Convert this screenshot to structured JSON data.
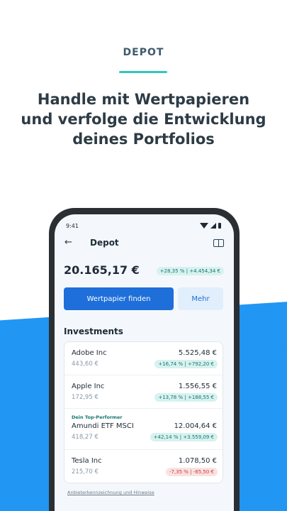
{
  "promo": {
    "tag": "DEPOT",
    "headline_line1": "Handle mit Wertpapieren",
    "headline_line2": "und verfolge die Entwicklung",
    "headline_line3": "deines Portfolios"
  },
  "status_bar": {
    "time": "9:41"
  },
  "app_bar": {
    "back_icon": "←",
    "title": "Depot",
    "info_icon": "book-icon"
  },
  "portfolio": {
    "total": "20.165,17 €",
    "change": "+28,35 % | +4.454,34 €"
  },
  "actions": {
    "primary_label": "Wertpapier finden",
    "secondary_label": "Mehr"
  },
  "investments": {
    "title": "Investments",
    "items": [
      {
        "name": "Adobe Inc",
        "value": "5.525,48 €",
        "price": "443,60 €",
        "change": "+16,74 % | +792,20 €",
        "trend": "pos",
        "tag": ""
      },
      {
        "name": "Apple Inc",
        "value": "1.556,55 €",
        "price": "172,95 €",
        "change": "+13,78 % | +188,55 €",
        "trend": "pos",
        "tag": ""
      },
      {
        "name": "Amundi ETF MSCI",
        "value": "12.004,64 €",
        "price": "418,27 €",
        "change": "+42,14 % | +3.559,09 €",
        "trend": "pos",
        "tag": "Dein Top-Performer"
      },
      {
        "name": "Tesla Inc",
        "value": "1.078,50 €",
        "price": "215,70 €",
        "change": "-7,35 % | -85,50 €",
        "trend": "neg",
        "tag": ""
      }
    ]
  },
  "footer": {
    "link": "Anbieterkennzeichnung und Hinweise"
  },
  "colors": {
    "primary": "#1e6fd9",
    "accent": "#35c6c0",
    "background_blue": "#2196f3",
    "positive": "#16756d",
    "negative": "#c73b3b"
  }
}
